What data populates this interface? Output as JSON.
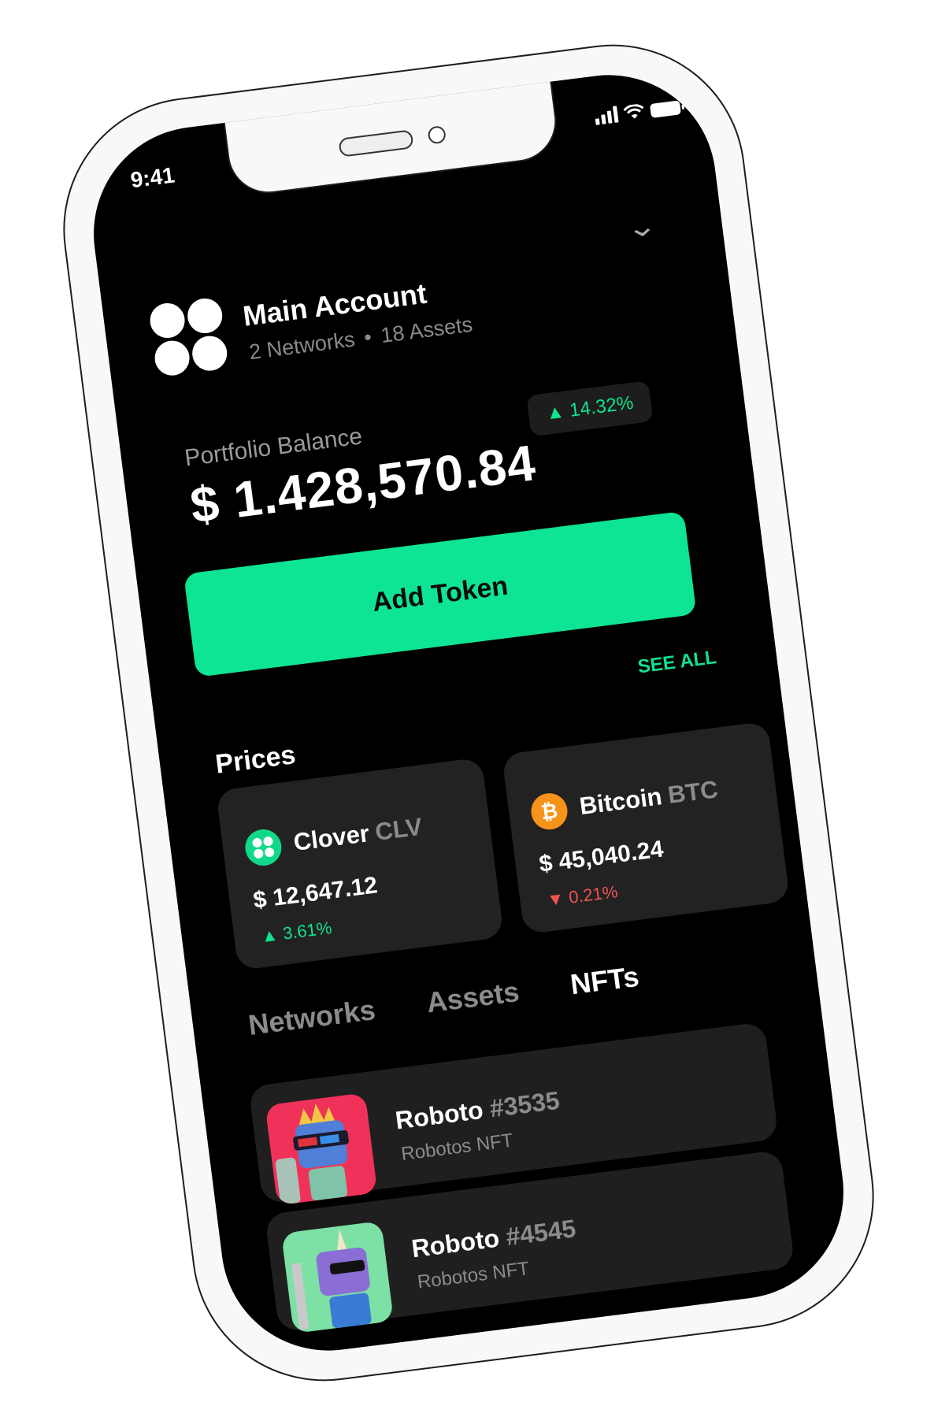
{
  "status_bar": {
    "time": "9:41"
  },
  "account": {
    "name": "Main Account",
    "networks": "2 Networks",
    "assets": "18 Assets",
    "separator": "•"
  },
  "portfolio": {
    "label": "Portfolio Balance",
    "balance": "$ 1.428,570.84",
    "change": "▲ 14.32%"
  },
  "add_token_label": "Add Token",
  "prices": {
    "title": "Prices",
    "see_all": "SEE ALL",
    "cards": [
      {
        "name": "Clover",
        "ticker": "CLV",
        "price": "$ 12,647.12",
        "change": "▲ 3.61%",
        "direction": "up"
      },
      {
        "name": "Bitcoin",
        "ticker": "BTC",
        "price": "$ 45,040.24",
        "change": "▼ 0.21%",
        "direction": "down",
        "icon_glyph": "₿"
      }
    ]
  },
  "tabs": [
    {
      "label": "Networks",
      "active": false
    },
    {
      "label": "Assets",
      "active": false
    },
    {
      "label": "NFTs",
      "active": true
    }
  ],
  "nfts": [
    {
      "name": "Roboto",
      "number": "#3535",
      "collection": "Robotos NFT"
    },
    {
      "name": "Roboto",
      "number": "#4545",
      "collection": "Robotos NFT"
    }
  ],
  "colors": {
    "accent": "#0ee594",
    "up": "#0ee38c",
    "down": "#f05252",
    "bitcoin": "#f7931a"
  }
}
